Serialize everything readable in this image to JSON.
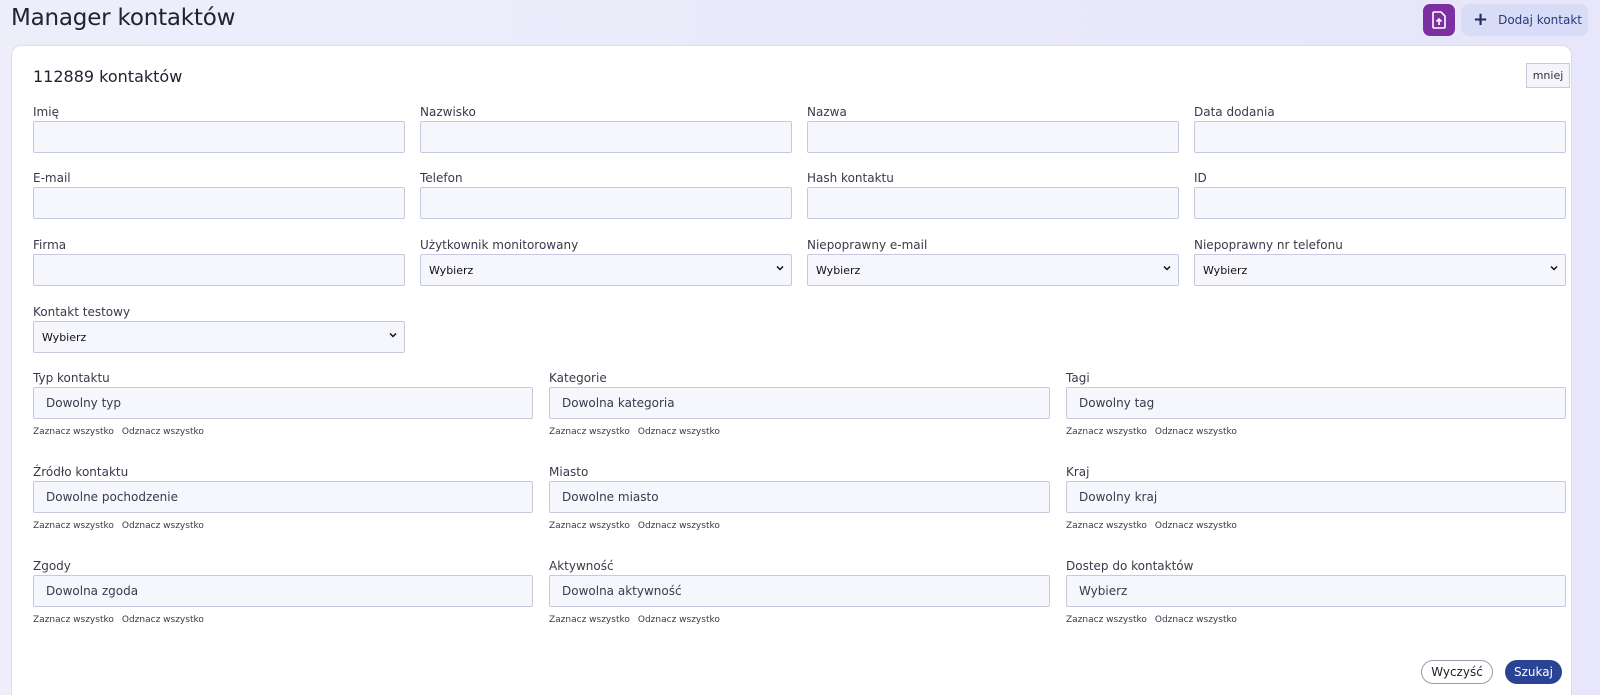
{
  "header": {
    "title": "Manager kontaktów",
    "import_icon": "file-upload-icon",
    "add_icon": "plus-icon",
    "add_label": "Dodaj kontakt"
  },
  "card": {
    "count_title": "112889 kontaktów",
    "less_label": "mniej"
  },
  "filters": {
    "text_fields": [
      {
        "label": "Imię",
        "value": ""
      },
      {
        "label": "Nazwisko",
        "value": ""
      },
      {
        "label": "Nazwa",
        "value": ""
      },
      {
        "label": "Data dodania",
        "value": ""
      },
      {
        "label": "E-mail",
        "value": ""
      },
      {
        "label": "Telefon",
        "value": ""
      },
      {
        "label": "Hash kontaktu",
        "value": ""
      },
      {
        "label": "ID",
        "value": ""
      },
      {
        "label": "Firma",
        "value": ""
      }
    ],
    "selects": [
      {
        "label": "Użytkownik monitorowany",
        "value": "Wybierz"
      },
      {
        "label": "Niepoprawny e-mail",
        "value": "Wybierz"
      },
      {
        "label": "Niepoprawny nr telefonu",
        "value": "Wybierz"
      },
      {
        "label": "Kontakt testowy",
        "value": "Wybierz"
      }
    ],
    "multi": [
      {
        "label": "Typ kontaktu",
        "value": "Dowolny typ"
      },
      {
        "label": "Kategorie",
        "value": "Dowolna kategoria"
      },
      {
        "label": "Tagi",
        "value": "Dowolny tag"
      },
      {
        "label": "Źródło kontaktu",
        "value": "Dowolne pochodzenie"
      },
      {
        "label": "Miasto",
        "value": "Dowolne miasto"
      },
      {
        "label": "Kraj",
        "value": "Dowolny kraj"
      },
      {
        "label": "Zgody",
        "value": "Dowolna zgoda"
      },
      {
        "label": "Aktywność",
        "value": "Dowolna aktywność"
      },
      {
        "label": "Dostep do kontaktów",
        "value": "Wybierz"
      }
    ],
    "select_all_label": "Zaznacz wszystko",
    "deselect_all_label": "Odznacz wszystko"
  },
  "actions": {
    "clear_label": "Wyczyść",
    "search_label": "Szukaj"
  },
  "colors": {
    "accent": "#2a4394",
    "import_button": "#7b2fa0",
    "add_button": "#d9dcf6"
  }
}
